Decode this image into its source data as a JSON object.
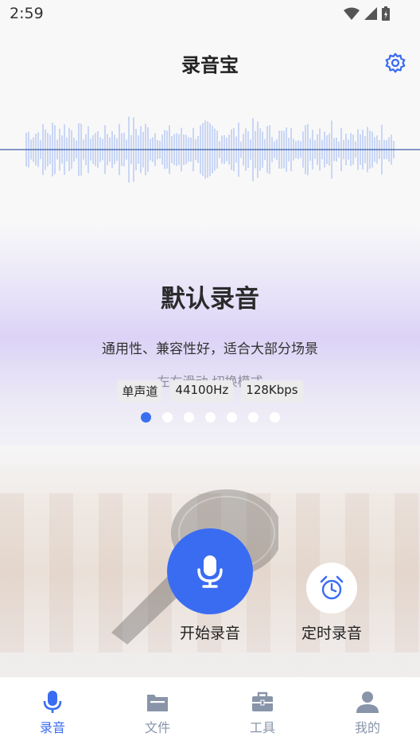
{
  "status_bar": {
    "time": "2:59"
  },
  "header": {
    "title": "录音宝",
    "settings_icon": "gear-icon"
  },
  "mode": {
    "title": "默认录音",
    "description": "通用性、兼容性好，适合大部分场景",
    "swipe_hint": "左右滑动 切换模式",
    "tags": [
      "单声道",
      "44100Hz",
      "128Kbps"
    ],
    "pager": {
      "count": 7,
      "active_index": 0
    }
  },
  "actions": {
    "record_label": "开始录音",
    "timer_label": "定时录音"
  },
  "bottom_nav": {
    "items": [
      {
        "label": "录音",
        "icon": "mic-icon",
        "active": true
      },
      {
        "label": "文件",
        "icon": "folder-icon",
        "active": false
      },
      {
        "label": "工具",
        "icon": "toolbox-icon",
        "active": false
      },
      {
        "label": "我的",
        "icon": "person-icon",
        "active": false
      }
    ]
  },
  "colors": {
    "accent": "#3a6cf2",
    "inactive": "#8894a8",
    "wave": "#c9d6f5"
  }
}
